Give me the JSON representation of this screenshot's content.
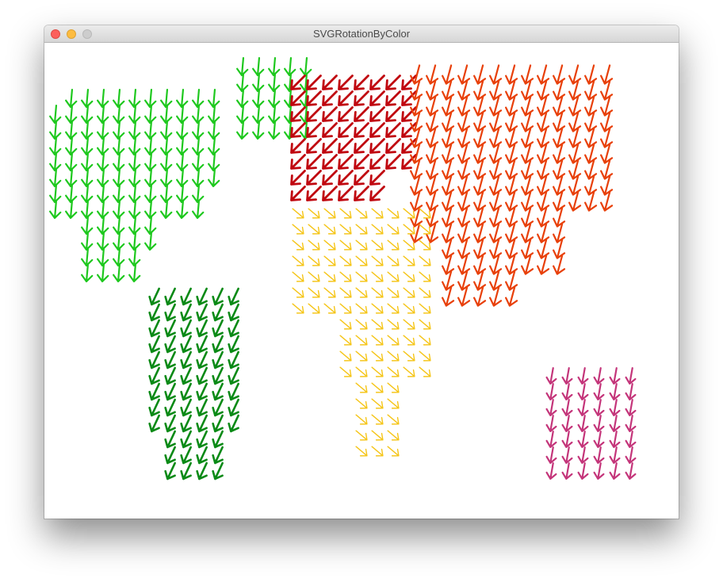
{
  "window": {
    "title": "SVGRotationByColor"
  },
  "colors": {
    "north_america": "#1ec81e",
    "south_america": "#0a8a16",
    "europe": "#c0060f",
    "asia": "#e8400a",
    "africa": "#f5c518",
    "oceania": "#c4357a"
  }
}
